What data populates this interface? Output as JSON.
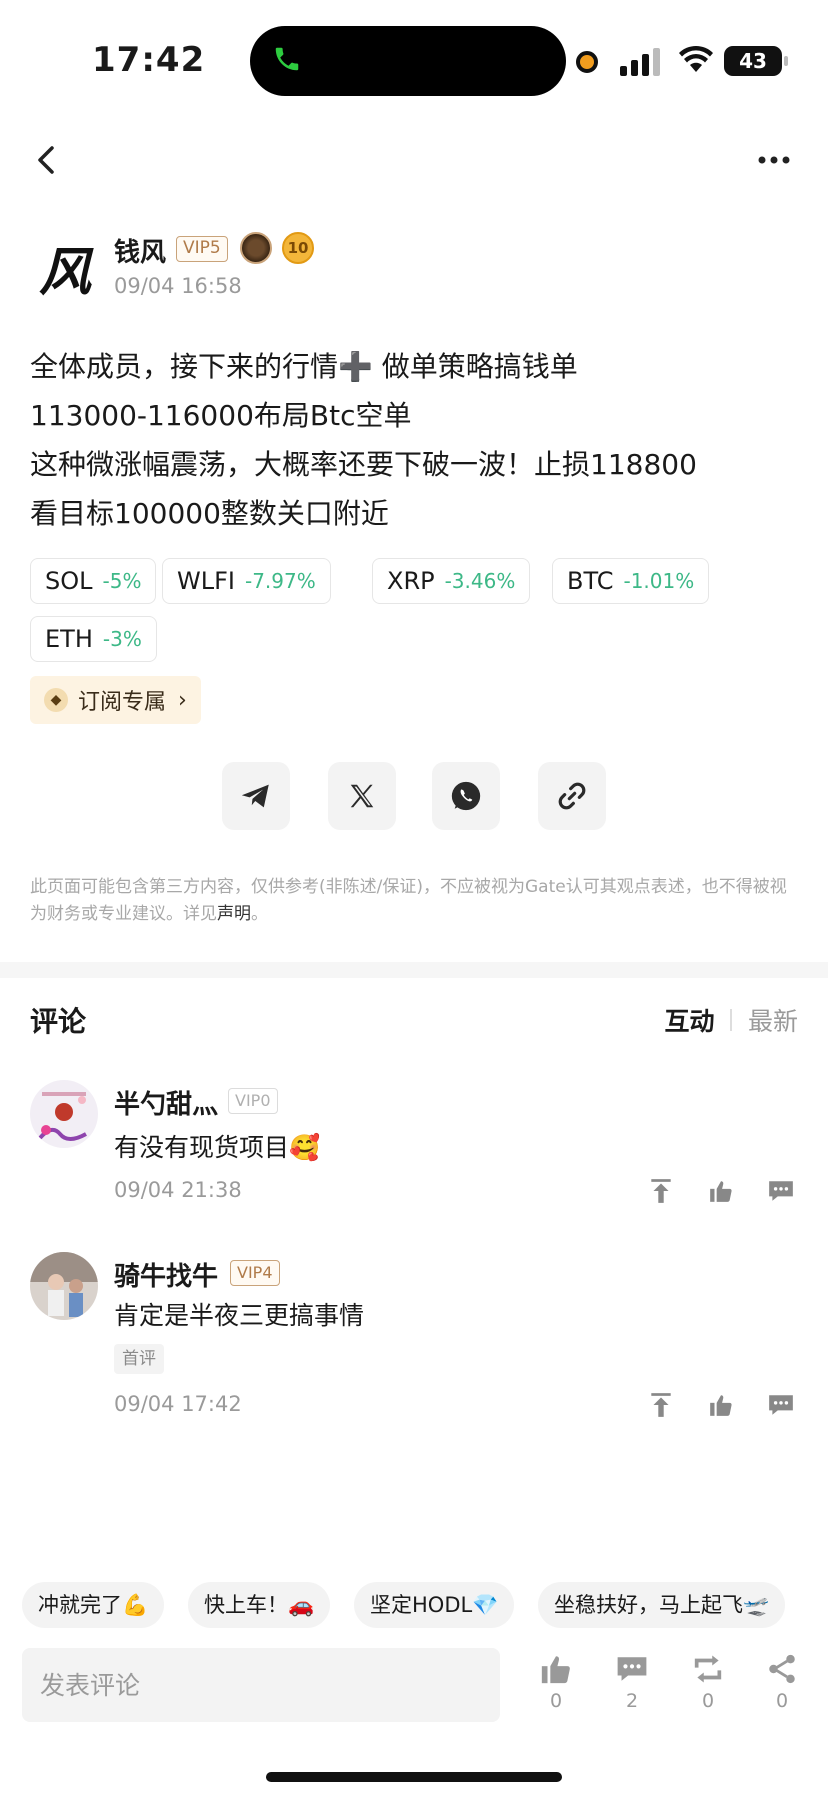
{
  "status_bar": {
    "time": "17:42",
    "battery": "43"
  },
  "author": {
    "avatar_char": "风",
    "name": "钱风",
    "vip": "VIP5",
    "medal_level": "10",
    "time": "09/04 16:58"
  },
  "post": {
    "lines": [
      "全体成员，接下来的行情➕ 做单策略搞钱单",
      "113000-116000布局Btc空单",
      "这种微涨幅震荡，大概率还要下破一波！止损118800",
      "看目标100000整数关口附近"
    ]
  },
  "tickers": [
    {
      "symbol": "SOL",
      "change": "-5%"
    },
    {
      "symbol": "WLFI",
      "change": "-7.97%"
    },
    {
      "symbol": "XRP",
      "change": "-3.46%"
    },
    {
      "symbol": "BTC",
      "change": "-1.01%"
    },
    {
      "symbol": "ETH",
      "change": "-3%"
    }
  ],
  "subscribe_label": "订阅专属",
  "disclaimer": {
    "text": "此页面可能包含第三方内容，仅供参考(非陈述/保证)，不应被视为Gate认可其观点表述，也不得被视为财务或专业建议。详见",
    "link": "声明",
    "end": "。"
  },
  "comments_section": {
    "title": "评论",
    "sort_active": "互动",
    "sort_other": "最新"
  },
  "comments": [
    {
      "name": "半勺甜灬",
      "vip": "VIP0",
      "text": "有没有现货项目🥰",
      "time": "09/04 21:38"
    },
    {
      "name": "骑牛找牛",
      "vip": "VIP4",
      "text": "肯定是半夜三更搞事情",
      "tag": "首评",
      "time": "09/04 17:42"
    }
  ],
  "quick_replies": [
    "冲就完了💪",
    "快上车！🚗",
    "坚定HODL💎",
    "坐稳扶好，马上起飞🛫"
  ],
  "bottom_bar": {
    "placeholder": "发表评论",
    "likes": "0",
    "comments": "2",
    "reposts": "0",
    "shares": "0"
  },
  "colors": {
    "up_green": "#3db887",
    "vip_gold": "#b07b4a",
    "subscribe_bg": "#fdf3e2"
  }
}
